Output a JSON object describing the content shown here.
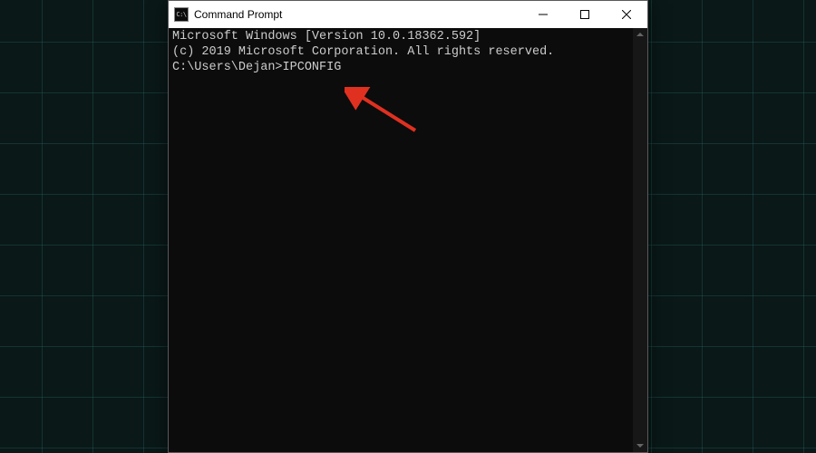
{
  "window": {
    "title": "Command Prompt",
    "icon_label": "C:\\"
  },
  "terminal": {
    "line1": "Microsoft Windows [Version 10.0.18362.592]",
    "line2": "(c) 2019 Microsoft Corporation. All rights reserved.",
    "blank": "",
    "prompt": "C:\\Users\\Dejan>",
    "command": "IPCONFIG"
  },
  "controls": {
    "minimize": "minimize",
    "maximize": "maximize",
    "close": "close"
  },
  "annotation": {
    "arrow_color": "#e03020"
  }
}
